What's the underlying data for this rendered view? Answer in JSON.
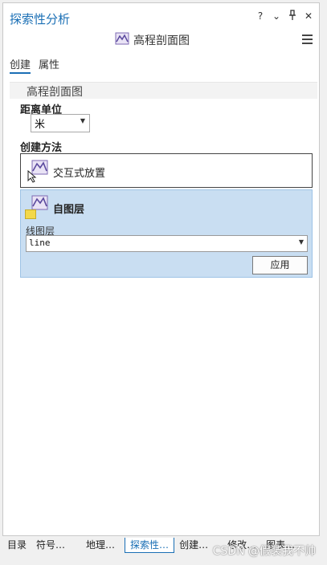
{
  "pane": {
    "title": "探索性分析",
    "icons": {
      "help": "?",
      "dropdown": "⌄",
      "pin": "pin-icon",
      "close": "✕"
    }
  },
  "tool": {
    "title": "高程剖面图",
    "icon": "elevation-profile-icon",
    "menu_icon": "hamburger-menu-icon"
  },
  "tabs": [
    {
      "label": "创建",
      "active": true
    },
    {
      "label": "属性",
      "active": false
    }
  ],
  "section": {
    "title": "高程剖面图"
  },
  "distance_unit": {
    "label": "距离单位",
    "value": "米"
  },
  "creation_method": {
    "label": "创建方法",
    "interactive": {
      "label": "交互式放置"
    },
    "from_layer": {
      "label": "自图层",
      "field_label": "线图层",
      "layer_value": "line",
      "apply_label": "应用"
    }
  },
  "bottom_tabs": [
    {
      "label": "目录",
      "active": false
    },
    {
      "label": "符号…",
      "active": false
    },
    {
      "label": "地理…",
      "active": false
    },
    {
      "label": "探索性…",
      "active": true
    },
    {
      "label": "创建…",
      "active": false
    },
    {
      "label": "修改…",
      "active": false
    },
    {
      "label": "图表…",
      "active": false
    }
  ],
  "watermark": "CSDN @假装我不帅",
  "colors": {
    "accent": "#1a6fb5",
    "selected_method_bg": "#c9def2"
  }
}
